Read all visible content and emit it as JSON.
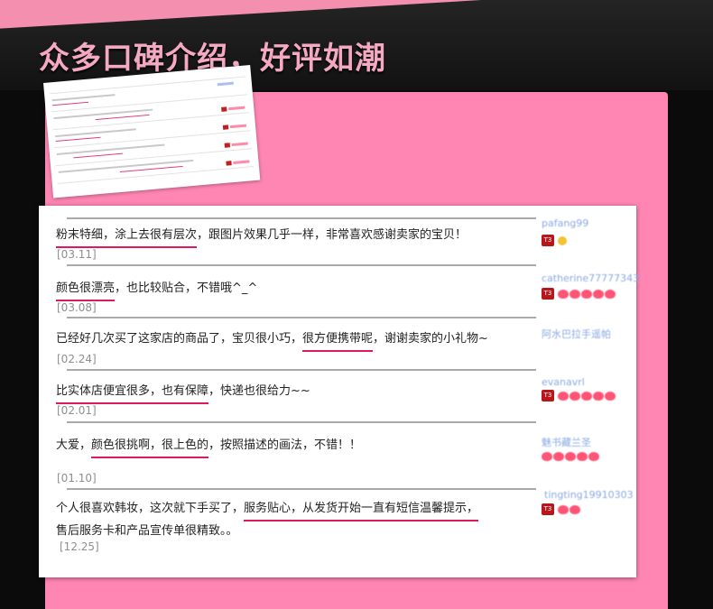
{
  "header": {
    "title": "众多口碑介绍，好评如潮"
  },
  "colors": {
    "accent_pink": "#ff86b3",
    "stripe_pink": "#f58fb0",
    "highlight_red": "#e0195d",
    "username_blue": "#8aa9e4"
  },
  "reviews": [
    {
      "segments": [
        {
          "text": "粉末特细，涂上去很有层次",
          "hl": true
        },
        {
          "text": "，跟图片效果几乎一样，非常喜欢感谢卖家的宝贝！",
          "hl": false
        }
      ],
      "date": "[03.11]",
      "user": "pafang99",
      "badge": "T3",
      "level": {
        "icon": "sun-icon",
        "count": 1
      }
    },
    {
      "segments": [
        {
          "text": "颜色很漂亮",
          "hl": true
        },
        {
          "text": "，也比较贴合，不错哦^_^",
          "hl": false
        }
      ],
      "date": "[03.08]",
      "user": "catherine77777343",
      "badge": "T3",
      "level": {
        "icon": "diamond-icon",
        "count": 5
      }
    },
    {
      "segments": [
        {
          "text": "已经好几次买了这家店的商品了，宝贝很小巧，",
          "hl": false
        },
        {
          "text": "很方便携带呢",
          "hl": true
        },
        {
          "text": "，谢谢卖家的小礼物~",
          "hl": false
        }
      ],
      "date": "[02.24]",
      "user": "阿水巴拉手遥帕",
      "badge": "",
      "level": {
        "icon": "none",
        "count": 0
      }
    },
    {
      "segments": [
        {
          "text": "比实体店便宜很多，也有保障",
          "hl": true
        },
        {
          "text": "，快递也很给力~~",
          "hl": false
        }
      ],
      "date": "[02.01]",
      "user": "evanavrl",
      "badge": "T3",
      "level": {
        "icon": "diamond-icon",
        "count": 5
      }
    },
    {
      "segments": [
        {
          "text": "大爱，",
          "hl": false
        },
        {
          "text": "颜色很挑啊，很上色的",
          "hl": true
        },
        {
          "text": "，按照描述的画法，不错！！",
          "hl": false
        }
      ],
      "date": "[01.10]",
      "user": "魅书藏兰圣",
      "badge": "",
      "level": {
        "icon": "diamond-icon",
        "count": 5
      }
    },
    {
      "segments": [
        {
          "text": "个人很喜欢韩妆，这次就下手买了，",
          "hl": false
        },
        {
          "text": "服务贴心，从发货开始一直有短信温馨提示，",
          "hl": true
        }
      ],
      "line2": "售后服务卡和产品宣传单很精致。。",
      "date": "[12.25]",
      "user": "tingting19910303",
      "badge": "T3",
      "level": {
        "icon": "diamond-icon",
        "count": 2
      }
    }
  ]
}
